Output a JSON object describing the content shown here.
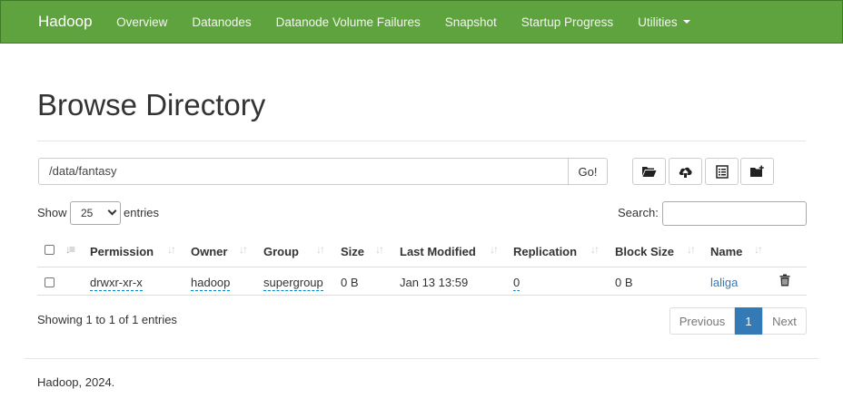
{
  "navbar": {
    "brand": "Hadoop",
    "items": [
      "Overview",
      "Datanodes",
      "Datanode Volume Failures",
      "Snapshot",
      "Startup Progress",
      "Utilities"
    ]
  },
  "page": {
    "title": "Browse Directory",
    "path": "/data/fantasy",
    "go_label": "Go!"
  },
  "toolbar": {
    "icons": [
      "folder-open-icon",
      "cloud-upload-icon",
      "list-alt-icon",
      "folder-plus-icon"
    ]
  },
  "table_controls": {
    "show_label": "Show",
    "page_length": "25",
    "entries_label": "entries",
    "search_label": "Search:",
    "search_value": ""
  },
  "table": {
    "columns": [
      "Permission",
      "Owner",
      "Group",
      "Size",
      "Last Modified",
      "Replication",
      "Block Size",
      "Name"
    ],
    "rows": [
      {
        "permission": "drwxr-xr-x",
        "owner": "hadoop",
        "group": "supergroup",
        "size": "0 B",
        "last_modified": "Jan 13 13:59",
        "replication": "0",
        "block_size": "0 B",
        "name": "laliga"
      }
    ]
  },
  "pagination": {
    "info": "Showing 1 to 1 of 1 entries",
    "previous": "Previous",
    "current": "1",
    "next": "Next"
  },
  "footer": {
    "text": "Hadoop, 2024."
  },
  "colors": {
    "navbar_bg": "#5fa33e",
    "link": "#337ab7",
    "active_page": "#337ab7"
  }
}
